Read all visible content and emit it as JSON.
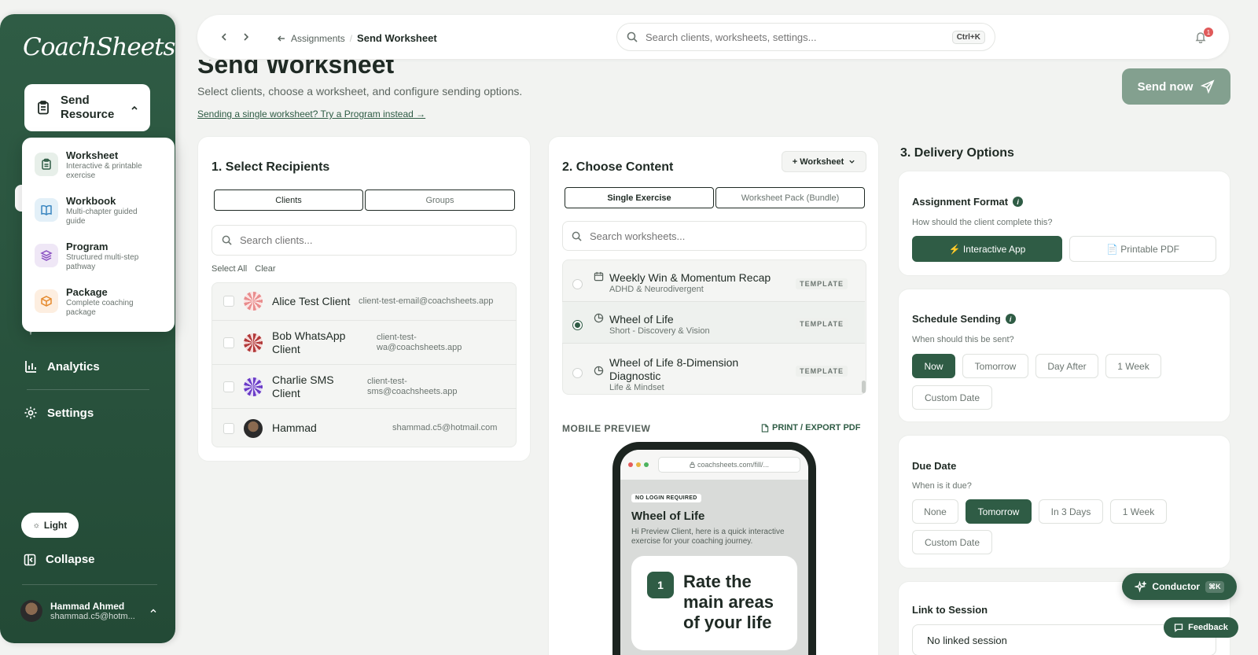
{
  "app": {
    "logo": "CoachSheets"
  },
  "sidebar": {
    "send_resource_label": "Send Resource",
    "dropdown": [
      {
        "title": "Worksheet",
        "sub": "Interactive & printable exercise",
        "color": "#e7efe9",
        "icon": "clipboard-icon"
      },
      {
        "title": "Workbook",
        "sub": "Multi-chapter guided guide",
        "color": "#e3f0f8",
        "icon": "book-icon"
      },
      {
        "title": "Program",
        "sub": "Structured multi-step pathway",
        "color": "#efe7f6",
        "icon": "layers-icon"
      },
      {
        "title": "Package",
        "sub": "Complete coaching package",
        "color": "#fdeee0",
        "icon": "box-icon"
      }
    ],
    "nav": [
      {
        "label": "Conductor",
        "icon": "sparkle-icon"
      },
      {
        "label": "Analytics",
        "icon": "bar-chart-icon"
      },
      {
        "label": "Settings",
        "icon": "gear-icon"
      }
    ],
    "theme_label": "Light",
    "collapse_label": "Collapse",
    "user": {
      "name": "Hammad Ahmed",
      "email": "shammad.c5@hotm..."
    }
  },
  "topbar": {
    "back_label": "Assignments",
    "current": "Send Worksheet",
    "search_placeholder": "Search clients, worksheets, settings...",
    "shortcut": "Ctrl+K",
    "notifications": "1"
  },
  "header": {
    "title": "Send Worksheet",
    "subtitle": "Select clients, choose a worksheet, and configure sending options.",
    "link": "Sending a single worksheet? Try a Program instead →",
    "send_now": "Send now"
  },
  "recipients": {
    "title": "1. Select Recipients",
    "tabs": [
      "Clients",
      "Groups"
    ],
    "search_placeholder": "Search clients...",
    "select_all": "Select All",
    "clear": "Clear",
    "rows": [
      {
        "name": "Alice Test Client",
        "email": "client-test-email@coachsheets.app",
        "avatar": "#e98d8d"
      },
      {
        "name": "Bob WhatsApp Client",
        "email": "client-test-wa@coachsheets.app",
        "avatar": "#b23a3a"
      },
      {
        "name": "Charlie SMS Client",
        "email": "client-test-sms@coachsheets.app",
        "avatar": "#6a3bc7"
      },
      {
        "name": "Hammad",
        "email": "shammad.c5@hotmail.com",
        "avatar": "#5a4636"
      }
    ]
  },
  "content": {
    "title": "2. Choose Content",
    "add_button": "+ Worksheet",
    "tabs": [
      "Single Exercise",
      "Worksheet Pack (Bundle)"
    ],
    "search_placeholder": "Search worksheets...",
    "badge": "TEMPLATE",
    "worksheets": [
      {
        "title": "Weekly Win & Momentum Recap",
        "sub": "ADHD & Neurodivergent",
        "selected": false
      },
      {
        "title": "Wheel of Life",
        "sub": "Short - Discovery & Vision",
        "selected": true
      },
      {
        "title": "Wheel of Life 8-Dimension Diagnostic",
        "sub": "Life & Mindset",
        "selected": false
      }
    ],
    "preview_label": "MOBILE PREVIEW",
    "export_label": "PRINT / EXPORT PDF",
    "phone": {
      "url": "coachsheets.com/fill/...",
      "badge": "NO LOGIN REQUIRED",
      "title": "Wheel of Life",
      "intro": "Hi Preview Client, here is a quick interactive exercise for your coaching journey.",
      "step_num": "1",
      "step_text": "Rate the main areas of your life"
    }
  },
  "delivery": {
    "title": "3. Delivery Options",
    "format": {
      "title": "Assignment Format",
      "sub": "How should the client complete this?",
      "options": [
        "⚡ Interactive App",
        "📄 Printable PDF"
      ],
      "selected": 0
    },
    "schedule": {
      "title": "Schedule Sending",
      "sub": "When should this be sent?",
      "options": [
        "Now",
        "Tomorrow",
        "Day After",
        "1 Week",
        "Custom Date"
      ],
      "selected": 0
    },
    "due": {
      "title": "Due Date",
      "sub": "When is it due?",
      "options": [
        "None",
        "Tomorrow",
        "In 3 Days",
        "1 Week",
        "Custom Date"
      ],
      "selected": 1
    },
    "session": {
      "title": "Link to Session",
      "value": "No linked session"
    }
  },
  "floating": {
    "conductor": "Conductor",
    "conductor_kbd": "⌘K",
    "feedback": "Feedback"
  },
  "colors": {
    "primary": "#2f5c45",
    "send_now": "#83a08f",
    "background": "#f2f3f1"
  }
}
